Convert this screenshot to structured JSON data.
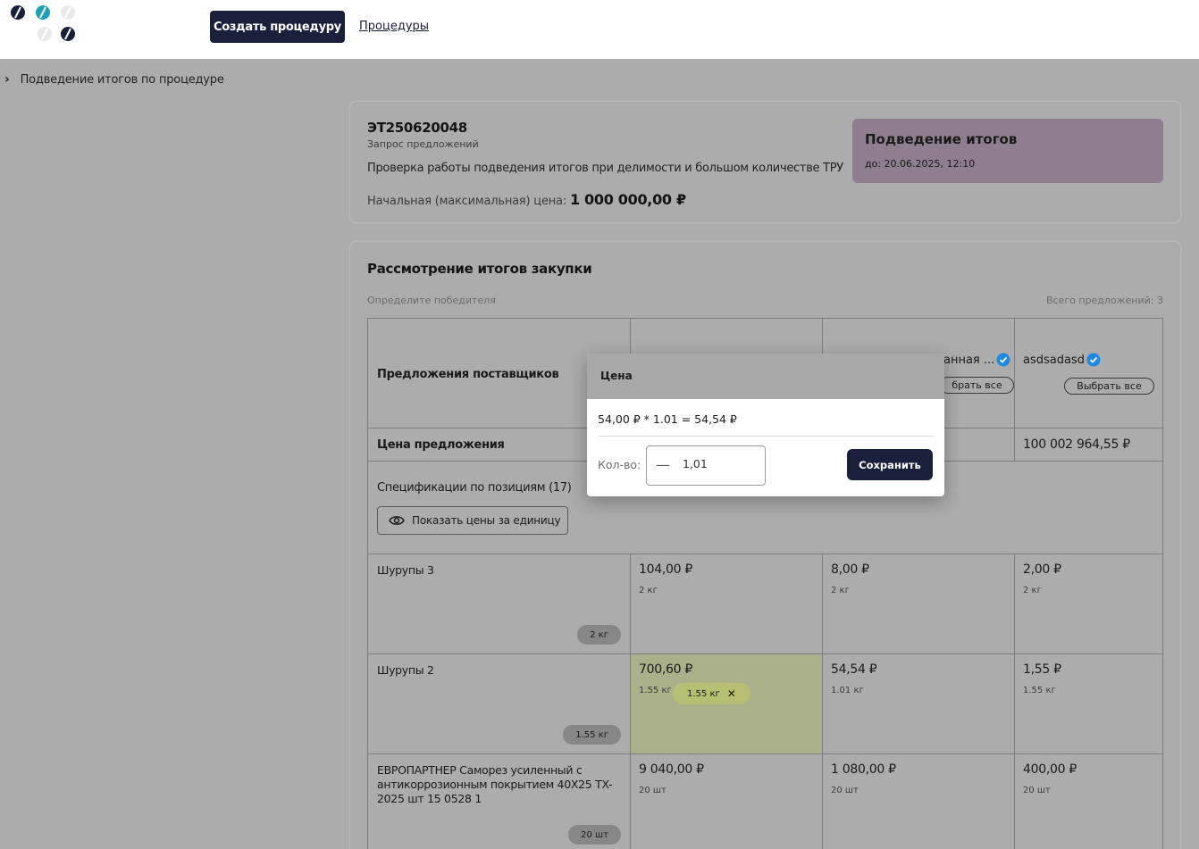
{
  "header": {
    "create_button": "Создать процедуру",
    "procedures_link": "Процедуры"
  },
  "breadcrumb": {
    "text": "Подведение итогов по процедуре"
  },
  "procedure": {
    "id": "ЭТ250620048",
    "type": "Запрос предложений",
    "description": "Проверка работы подведения итогов при делимости и большом количестве ТРУ",
    "price_label": "Начальная (максимальная) цена:",
    "price_value": "1 000 000,00 ₽",
    "status_title": "Подведение итогов",
    "status_deadline": "до: 20.06.2025, 12:10"
  },
  "review": {
    "title": "Рассмотрение итогов закупки",
    "hint": "Определите победителя",
    "total_offers": "Всего предложений: 3",
    "row_suppliers_label": "Предложения поставщиков",
    "row_price_label": "Цена предложения",
    "spec_title": "Спецификации по позициям (17)",
    "show_unit_prices": "Показать цены за единицу",
    "suppliers": [
      {
        "name": "",
        "select_all": "",
        "offer_price": ""
      },
      {
        "name": "анная ...",
        "select_all": "брать все",
        "offer_price": ""
      },
      {
        "name": "asdsadasd",
        "select_all": "Выбрать все",
        "offer_price": "100 002 964,55 ₽"
      }
    ],
    "items": [
      {
        "name": "Шурупы 3",
        "qty_chip": "2 кг",
        "offers": [
          {
            "price": "104,00 ₽",
            "qty": "2 кг"
          },
          {
            "price": "8,00 ₽",
            "qty": "2 кг"
          },
          {
            "price": "2,00 ₽",
            "qty": "2 кг"
          }
        ]
      },
      {
        "name": "Шурупы 2",
        "qty_chip": "1.55 кг",
        "offers": [
          {
            "price": "700,60 ₽",
            "qty": "1.55 кг",
            "selected_chip": "1.55 кг"
          },
          {
            "price": "54,54 ₽",
            "qty": "1.01 кг"
          },
          {
            "price": "1,55 ₽",
            "qty": "1.55 кг"
          }
        ]
      },
      {
        "name": "ЕВРОПАРТНЕР Саморез усиленный с антикоррозионным покрытием 40X25 TX-2025 шт 15 0528 1",
        "qty_chip": "20 шт",
        "offers": [
          {
            "price": "9 040,00 ₽",
            "qty": "20 шт"
          },
          {
            "price": "1 080,00 ₽",
            "qty": "20 шт"
          },
          {
            "price": "400,00 ₽",
            "qty": "20 шт"
          }
        ]
      }
    ]
  },
  "modal": {
    "title": "Цена",
    "formula": "54,00 ₽ * 1.01 = 54,54 ₽",
    "qty_label": "Кол-во:",
    "qty_value": "1,01",
    "minus": "—",
    "save_button": "Сохранить"
  },
  "icons": {
    "verified": "verified-badge-icon",
    "eye": "eye-icon",
    "close": "close-icon",
    "chevron": "chevron-right-icon"
  },
  "colors": {
    "brand_dark": "#1a1f3c",
    "accent_teal": "#1aa3b8",
    "status_purple": "#8e7e90",
    "selected_green": "#b6bf72",
    "verified_blue": "#1e88e5"
  }
}
